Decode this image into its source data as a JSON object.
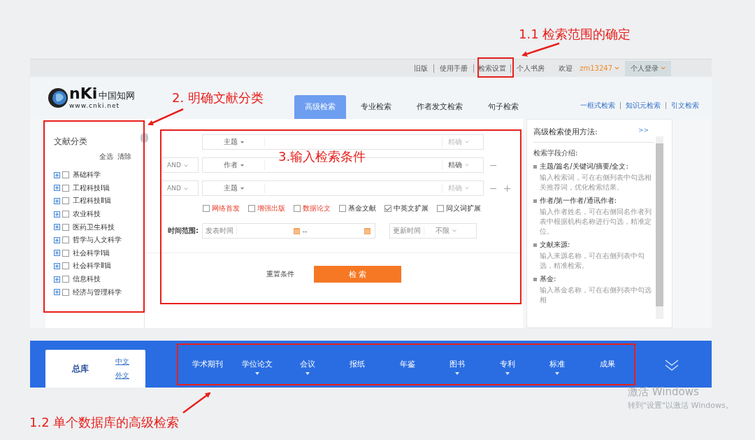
{
  "annotations": [
    {
      "text": "1.1 检索范围的确定"
    },
    {
      "text": "2. 明确文献分类"
    },
    {
      "text": "3.输入检索条件"
    },
    {
      "text": "1.2 单个数据库的高级检索"
    }
  ],
  "top_links": [
    {
      "label": "旧版",
      "boxed": false
    },
    {
      "label": "使用手册",
      "boxed": false
    },
    {
      "label": "检索设置",
      "boxed": true
    },
    {
      "label": "个人书房",
      "boxed": false
    }
  ],
  "welcome": "欢迎",
  "user": "zm13247",
  "login": "个人登录",
  "logo": {
    "mark": "nKi",
    "cn_name": "中国知网",
    "url": "www.cnki.net"
  },
  "tabs": [
    {
      "label": "高级检索",
      "selected": true
    },
    {
      "label": "专业检索",
      "selected": false
    },
    {
      "label": "作者发文检索",
      "selected": false
    },
    {
      "label": "句子检索",
      "selected": false
    }
  ],
  "side_links": [
    "一框式检索",
    "知识元检索",
    "引文检索"
  ],
  "sidebar": {
    "title": "文献分类",
    "select_all": "全选",
    "clear": "清除",
    "items": [
      {
        "label": "基础科学",
        "checked": false
      },
      {
        "label": "工程科技Ⅰ辑",
        "checked": false
      },
      {
        "label": "工程科技Ⅱ辑",
        "checked": false
      },
      {
        "label": "农业科技",
        "checked": false
      },
      {
        "label": "医药卫生科技",
        "checked": false
      },
      {
        "label": "哲学与人文科学",
        "checked": false
      },
      {
        "label": "社会科学Ⅰ辑",
        "checked": false
      },
      {
        "label": "社会科学Ⅱ辑",
        "checked": false
      },
      {
        "label": "信息科技",
        "checked": false
      },
      {
        "label": "经济与管理科学",
        "checked": false
      }
    ]
  },
  "search_rows": [
    {
      "field": "主题",
      "match": "精确",
      "match_disabled": true,
      "actions": []
    },
    {
      "operator": "AND",
      "field": "作者",
      "match": "精确",
      "match_disabled": false,
      "actions": [
        "−"
      ]
    },
    {
      "operator": "AND",
      "field": "主题",
      "match": "精确",
      "match_disabled": true,
      "actions": [
        "−",
        "+"
      ]
    }
  ],
  "options": [
    {
      "label": "网络首发",
      "checked": false,
      "kind": "featured"
    },
    {
      "label": "增强出版",
      "checked": false,
      "kind": "featured"
    },
    {
      "label": "数据论文",
      "checked": false,
      "kind": "featured"
    },
    {
      "label": "基金文献",
      "checked": false,
      "kind": "plain"
    },
    {
      "label": "中英文扩展",
      "checked": true,
      "kind": "plain"
    },
    {
      "label": "同义词扩展",
      "checked": false,
      "kind": "plain"
    }
  ],
  "time_range": {
    "label": "时间范围:",
    "publish_placeholder": "发表时间",
    "dash": "--",
    "update_label": "更新时间",
    "update_value": "不限"
  },
  "reset": "重置条件",
  "search": "检 索",
  "help": {
    "title": "高级检索使用方法:",
    "more": ">>",
    "intro": "检索字段介绍:",
    "sections": [
      {
        "heading": "主题/篇名/关键词/摘要/全文:",
        "text": "输入检索词，可在右侧列表中勾选相关推荐词，优化检索结果。"
      },
      {
        "heading": "作者/第一作者/通讯作者:",
        "text": "输入作者姓名，可在右侧同名作者列表中根据机构名称进行勾选，精准定位。"
      },
      {
        "heading": "文献来源:",
        "text": "输入来源名称，可在右侧列表中勾选，精准检索。"
      },
      {
        "heading": "基金:",
        "text": "输入基金名称，可在右侧列表中勾选相"
      }
    ]
  },
  "databases": {
    "main": "总库",
    "langs": [
      "中文",
      "外文"
    ],
    "items": [
      {
        "label": "学术期刊",
        "has_menu": false
      },
      {
        "label": "学位论文",
        "has_menu": true
      },
      {
        "label": "会议",
        "has_menu": true
      },
      {
        "label": "报纸",
        "has_menu": false
      },
      {
        "label": "年鉴",
        "has_menu": false
      },
      {
        "label": "图书",
        "has_menu": true
      },
      {
        "label": "专利",
        "has_menu": true
      },
      {
        "label": "标准",
        "has_menu": true
      },
      {
        "label": "成果",
        "has_menu": false
      }
    ]
  },
  "watermark": {
    "line1": "激活 Windows",
    "line2": "转到\"设置\"以激活 Windows。"
  }
}
